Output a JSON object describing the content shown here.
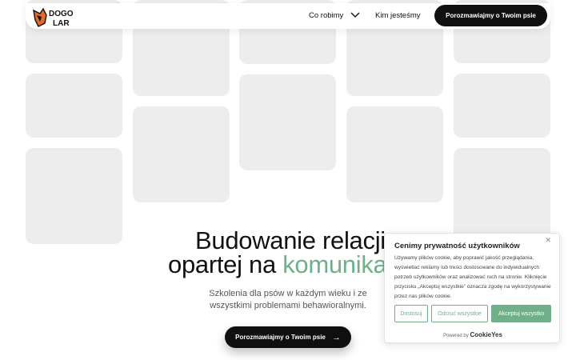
{
  "nav": {
    "logo_text": "DOGOLAR",
    "items": [
      "Co robimy",
      "Kim jesteśmy"
    ],
    "cta": "Porozmawiajmy o Twoim psie",
    "chevron_icon": "chevron-down-icon"
  },
  "hero": {
    "title_line1": "Budowanie relacji",
    "title_line2_start": "opartej na ",
    "title_line2_accent": "komunika",
    "subtitle_line1": "Szkolenia dla psów w każdym wieku i ze",
    "subtitle_line2": "wszystkimi problemami behawioralnymi.",
    "cta": "Porozmawiajmy o Twoim psie",
    "cta_icon": "arrow-right-icon"
  },
  "cookie": {
    "title": "Cenimy prywatność użytkowników",
    "close_icon": "close-icon",
    "text": "Używamy plików cookie, aby poprawić jakość przeglądania, wyświetlać reklamy lub treści dostosowane do indywidualnych potrzeb użytkowników oraz analizować ruch na stronie. Kliknięcie przycisku „Akceptuj wszystkie” oznacza zgodę na wykorzystywanie przez nas plików cookie.",
    "buttons": [
      "Dostosuj",
      "Odrzuć wszystkie",
      "Akceptuj wszystko"
    ],
    "powered_by": "Powered by",
    "brand": "CookieYes"
  },
  "colors": {
    "accent": "#6fb08a",
    "dark": "#0f0f0f",
    "card": "#ededed"
  }
}
